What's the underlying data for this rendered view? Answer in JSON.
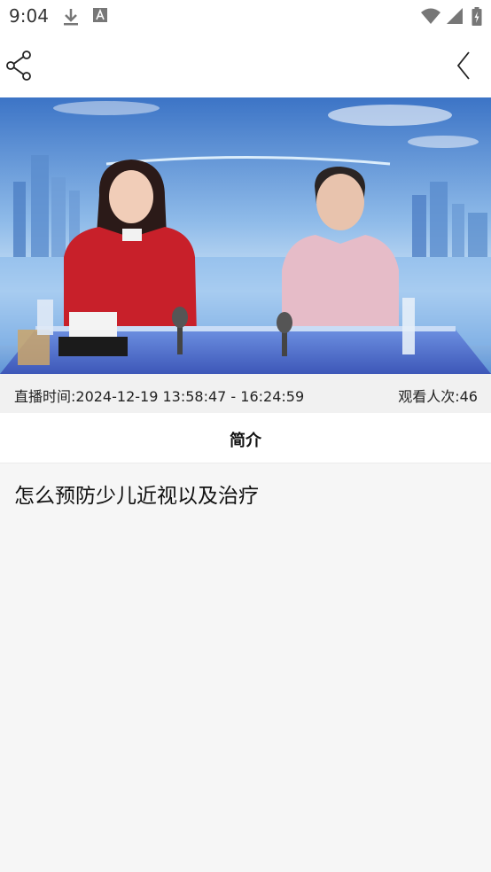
{
  "status_bar": {
    "time": "9:04",
    "icons": [
      "download-icon",
      "keyboard-a-icon",
      "wifi-icon",
      "signal-icon",
      "battery-charging-icon"
    ]
  },
  "header": {
    "share_icon": "share-icon",
    "back_icon": "chevron-left-icon"
  },
  "video": {
    "description": "two presenters at a studio news desk with a blue city skyline backdrop"
  },
  "info": {
    "live_time": "直播时间:2024-12-19 13:58:47 - 16:24:59",
    "view_count": "观看人次:46"
  },
  "tabs": [
    {
      "label": "简介"
    }
  ],
  "content": {
    "description": "怎么预防少儿近视以及治疗"
  }
}
